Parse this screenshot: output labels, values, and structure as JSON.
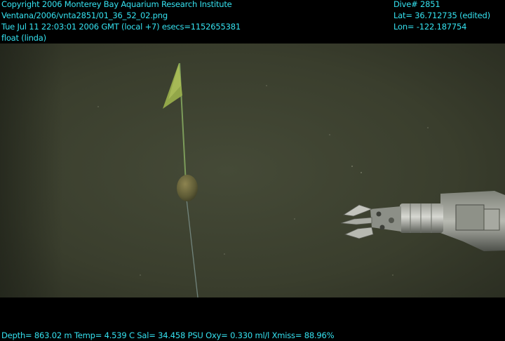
{
  "overlay": {
    "header_left": [
      "Copyright 2006 Monterey Bay Aquarium Research Institute",
      "Ventana/2006/vnta2851/01_36_52_02.png",
      "Tue Jul 11 22:03:01 2006 GMT (local +7)  esecs=1152655381",
      "float (linda)"
    ],
    "header_right": [
      "Dive# 2851",
      "Lat= 36.712735 (edited)",
      "Lon= -122.187754"
    ],
    "footer": "Depth= 863.02 m  Temp= 4.539 C  Sal= 34.458 PSU  Oxy= 0.330 ml/l  Xmiss= 88.96%",
    "text_color": "#35e2f0"
  },
  "scene": {
    "water_color": "#3b3f2e",
    "subjects": [
      "float-flag",
      "float-ball",
      "float-line",
      "robotic-arm-claw"
    ]
  }
}
